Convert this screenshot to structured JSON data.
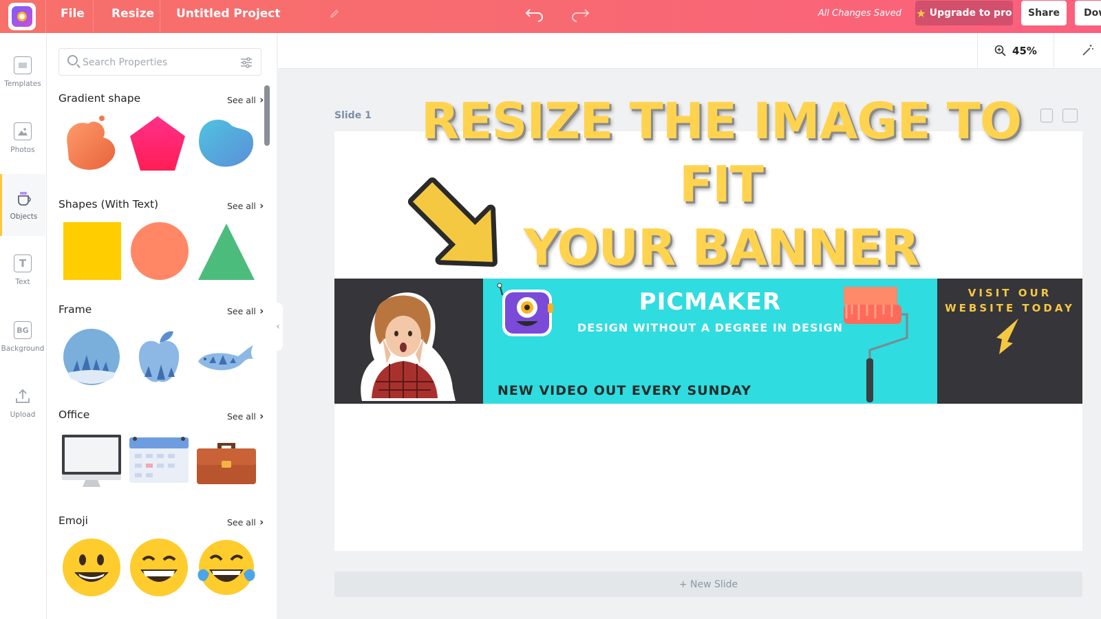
{
  "topbar": {
    "file_label": "File",
    "resize_label": "Resize",
    "project_title": "Untitled Project",
    "status": "All Changes Saved",
    "upgrade_label": "Upgrade to pro",
    "share_label": "Share",
    "download_label": "Dow"
  },
  "rail": {
    "items": [
      {
        "label": "Templates",
        "icon": "templates-icon"
      },
      {
        "label": "Photos",
        "icon": "photos-icon"
      },
      {
        "label": "Objects",
        "icon": "objects-icon",
        "active": true
      },
      {
        "label": "Text",
        "icon": "text-icon"
      },
      {
        "label": "Background",
        "icon": "background-icon",
        "glyph": "BG"
      },
      {
        "label": "Upload",
        "icon": "upload-icon"
      }
    ]
  },
  "panel": {
    "search_placeholder": "Search Properties",
    "see_all": "See all",
    "sections": [
      {
        "title": "Gradient shape"
      },
      {
        "title": "Shapes (With Text)"
      },
      {
        "title": "Frame"
      },
      {
        "title": "Office"
      },
      {
        "title": "Emoji"
      }
    ]
  },
  "canvas": {
    "zoom": "45%",
    "slide_label": "Slide 1",
    "new_slide_label": "+ New Slide",
    "headline_line1": "RESIZE THE IMAGE TO FIT",
    "headline_line2": "YOUR BANNER"
  },
  "banner": {
    "title": "PICMAKER",
    "subtitle": "DESIGN WITHOUT A DEGREE IN DESIGN",
    "bottom_text": "NEW VIDEO OUT EVERY SUNDAY",
    "visit_line1": "VISIT OUR",
    "visit_line2": "WEBSITE TODAY"
  },
  "colors": {
    "topbar_start": "#f7706a",
    "topbar_end": "#fb5f7e",
    "banner_dark": "#363539",
    "banner_cyan": "#2fdcdf",
    "headline_yellow": "#ffd34e",
    "active_rail_accent": "#ffc83a"
  }
}
